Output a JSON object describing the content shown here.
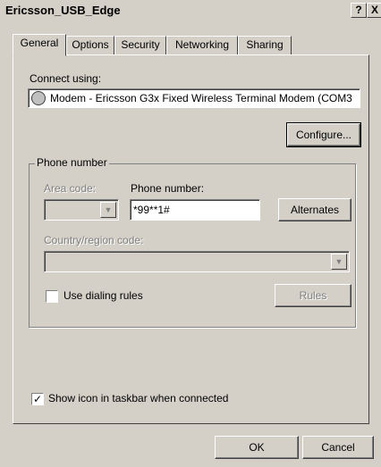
{
  "window": {
    "title": "Ericsson_USB_Edge",
    "help_glyph": "?",
    "close_glyph": "X"
  },
  "tabs": [
    {
      "label": "General",
      "active": true
    },
    {
      "label": "Options",
      "active": false
    },
    {
      "label": "Security",
      "active": false
    },
    {
      "label": "Networking",
      "active": false
    },
    {
      "label": "Sharing",
      "active": false
    }
  ],
  "general": {
    "connect_using_label": "Connect using:",
    "modem_name": "Modem - Ericsson G3x Fixed Wireless Terminal Modem (COM3",
    "configure_button": "Configure...",
    "phone_group_label": "Phone number",
    "area_code_label": "Area code:",
    "area_code_value": "",
    "phone_number_label": "Phone number:",
    "phone_number_value": "*99**1#",
    "alternates_button": "Alternates",
    "country_label": "Country/region code:",
    "country_value": "",
    "use_dialing_rules_label": "Use dialing rules",
    "use_dialing_rules_checked": false,
    "rules_button": "Rules",
    "show_icon_label": "Show icon in taskbar when connected",
    "show_icon_checked": true
  },
  "footer": {
    "ok_button": "OK",
    "cancel_button": "Cancel"
  }
}
